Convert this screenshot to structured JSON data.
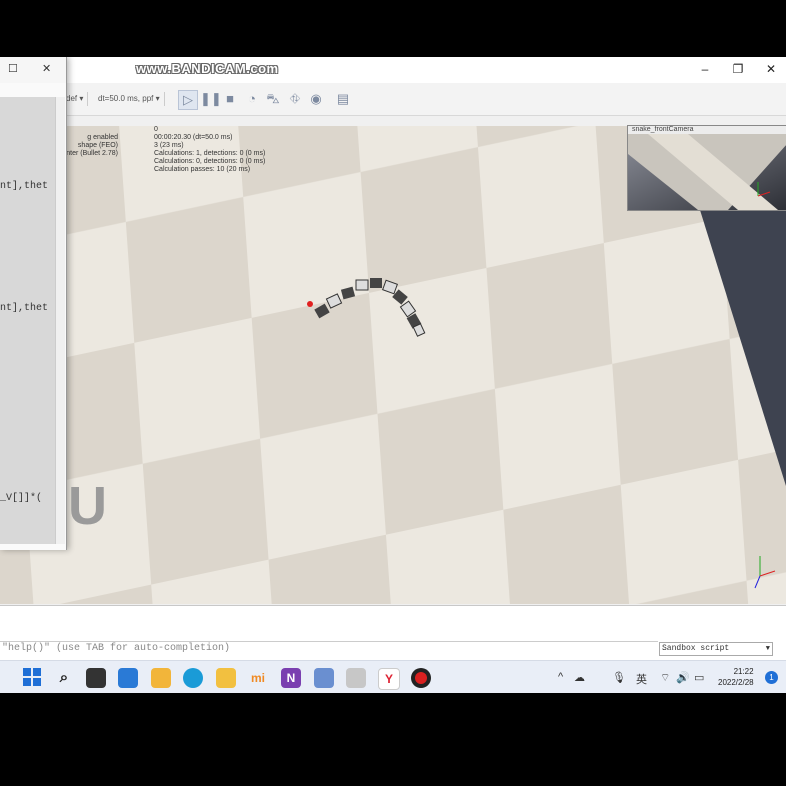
{
  "watermark": "www.BANDICAM.com",
  "window": {
    "min": "–",
    "restore": "❐",
    "close": "✕"
  },
  "editor_window": {
    "max": "☐",
    "close": "✕",
    "code_lines": [
      "nt],thet",
      "nt],thet",
      "_V[]]*("
    ],
    "big_letter": "U"
  },
  "toolbar": {
    "select_1": "def ▾",
    "select_2": "dt=50.0 ms, ppf ▾",
    "icons": [
      "play-icon",
      "pause-icon",
      "stop-icon",
      "realtime-icon",
      "vehicle-icon",
      "threaded-icon",
      "eye-icon",
      "layers-icon"
    ]
  },
  "hud": {
    "left_lines": [
      "g enabled",
      "shape (FEO)",
      "enter (Bullet 2.78)"
    ],
    "right_lines": [
      "0",
      "00:00:20.30 (dt=50.0 ms)",
      "3 (23 ms)",
      "Calculations: 1, detections: 0 (0 ms)",
      "Calculations: 0, detections: 0 (0 ms)",
      "Calculation passes: 10 (20 ms)"
    ]
  },
  "floating_view": {
    "title": "snake_frontCamera"
  },
  "command_line": {
    "placeholder": "\"help()\" (use TAB for auto-completion)"
  },
  "script_select": {
    "value": "Sandbox script"
  },
  "taskbar": {
    "apps": [
      "start-icon",
      "search-icon",
      "task-view-icon",
      "widgets-icon",
      "file-explorer-icon",
      "edge-icon",
      "maps-icon",
      "mi-icon",
      "onenote-icon",
      "photo-icon",
      "robot-icon",
      "coppelia-icon",
      "record-icon"
    ],
    "tray": {
      "chevron": "^",
      "lang": "英",
      "wifi": "⌔",
      "volume": "🔊",
      "notif": "1"
    },
    "time": "21:22",
    "date": "2022/2/28"
  },
  "colors": {
    "accent_orange": "#f2a23a",
    "record_red": "#d92020",
    "start_blue": "#1f6fd6"
  }
}
